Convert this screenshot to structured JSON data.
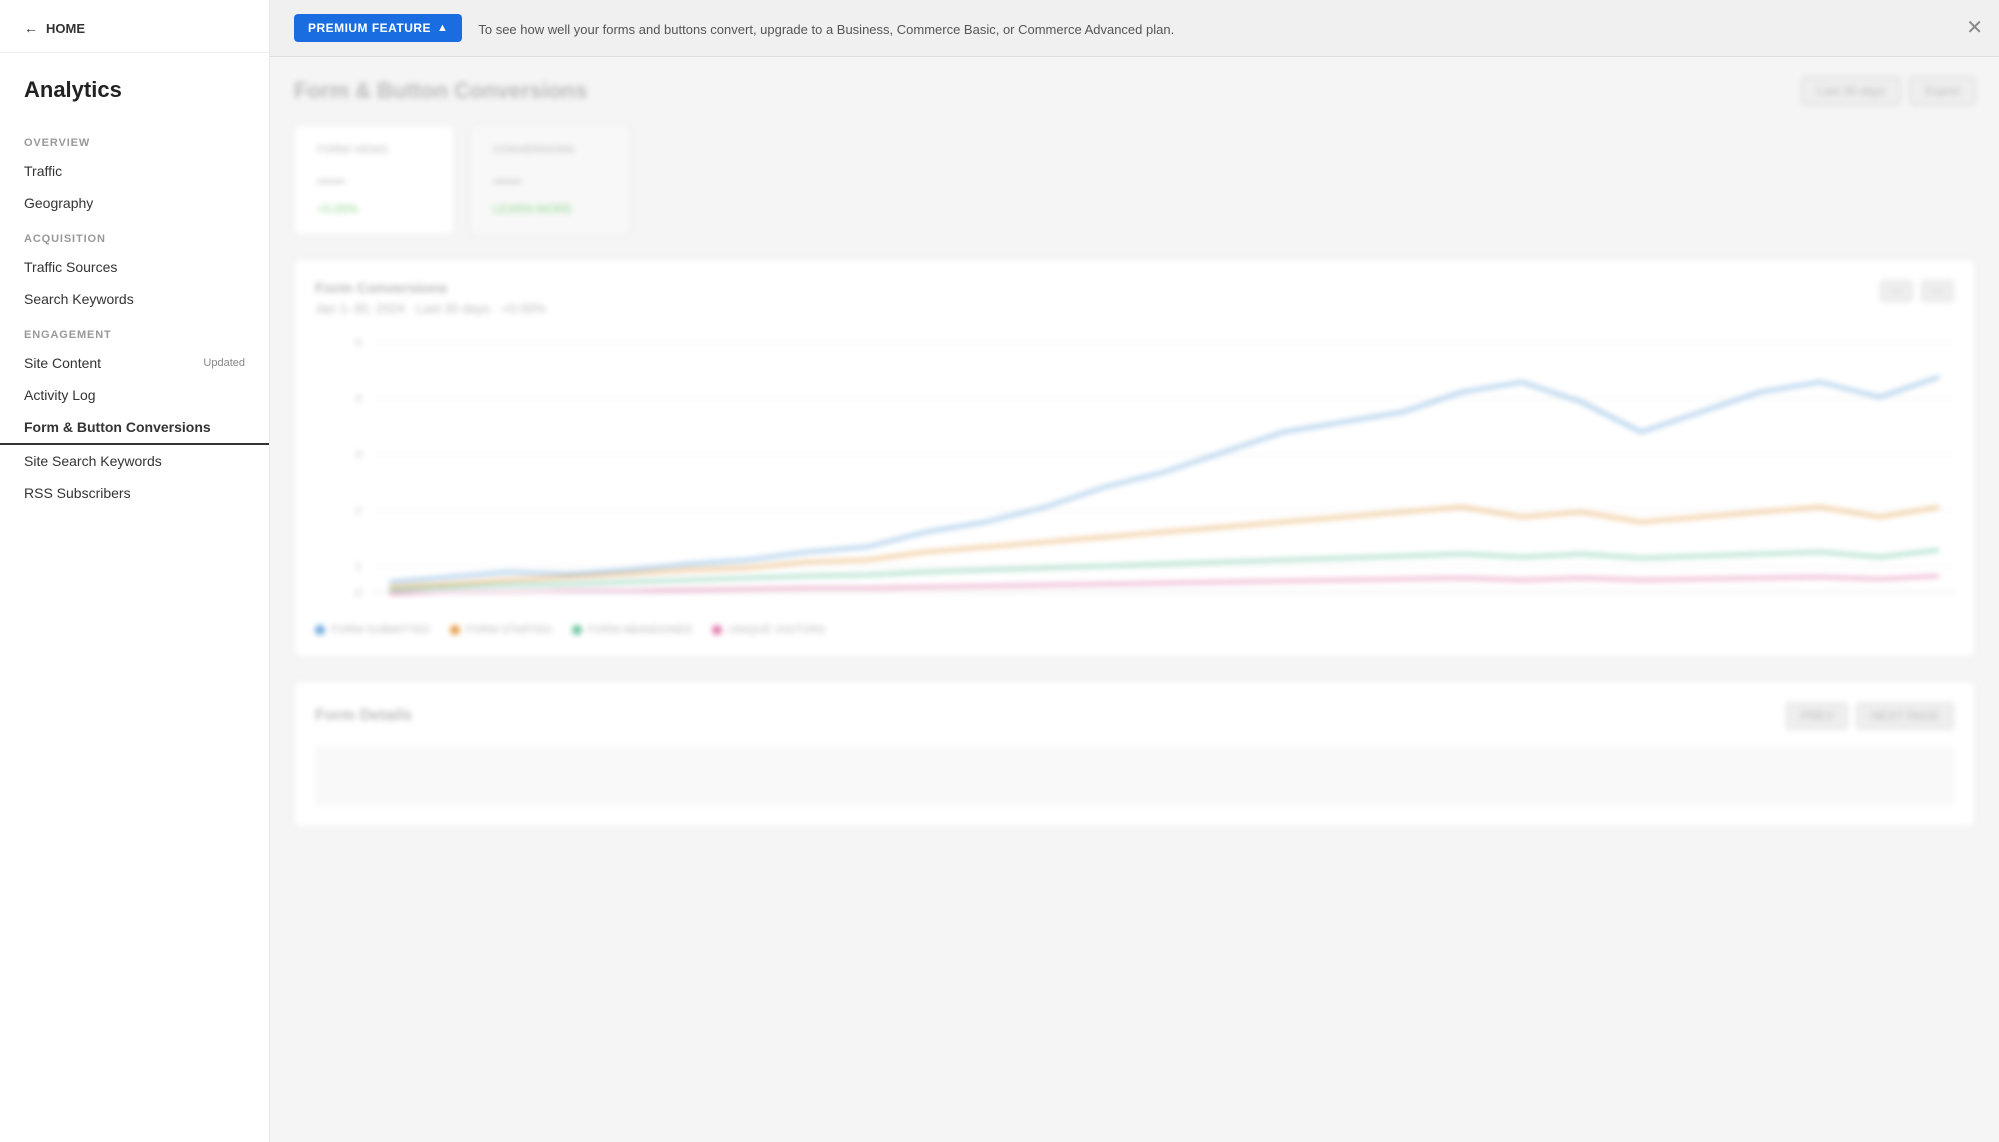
{
  "sidebar": {
    "home_label": "HOME",
    "title": "Analytics",
    "sections": [
      {
        "label": "OVERVIEW",
        "items": [
          {
            "id": "traffic",
            "label": "Traffic",
            "active": false,
            "badge": ""
          },
          {
            "id": "geography",
            "label": "Geography",
            "active": false,
            "badge": ""
          }
        ]
      },
      {
        "label": "ACQUISITION",
        "items": [
          {
            "id": "traffic-sources",
            "label": "Traffic Sources",
            "active": false,
            "badge": ""
          },
          {
            "id": "search-keywords",
            "label": "Search Keywords",
            "active": false,
            "badge": ""
          }
        ]
      },
      {
        "label": "ENGAGEMENT",
        "items": [
          {
            "id": "site-content",
            "label": "Site Content",
            "active": false,
            "badge": "Updated"
          },
          {
            "id": "activity-log",
            "label": "Activity Log",
            "active": false,
            "badge": ""
          },
          {
            "id": "form-button-conversions",
            "label": "Form & Button Conversions",
            "active": true,
            "badge": ""
          },
          {
            "id": "site-search-keywords",
            "label": "Site Search Keywords",
            "active": false,
            "badge": ""
          },
          {
            "id": "rss-subscribers",
            "label": "RSS Subscribers",
            "active": false,
            "badge": ""
          }
        ]
      }
    ]
  },
  "premium_banner": {
    "button_label": "PREMIUM FEATURE",
    "description": "To see how well your forms and buttons convert, upgrade to a Business, Commerce Basic, or Commerce Advanced plan."
  },
  "content": {
    "title": "Form & Button Conversions",
    "date_range": "Last 30 days",
    "export_label": "Export",
    "stat1": {
      "label": "FORM VIEWS",
      "value": "—",
      "change": "+0.00%"
    },
    "stat2": {
      "label": "CONVERSIONS",
      "value": "—",
      "change": "LEARN MORE"
    },
    "chart_subtitle": "Form Conversions",
    "chart_desc": "Jan 1–30, 2024 · Last 30 days · +0.00%",
    "y_labels": [
      "5",
      "4",
      "3",
      "2",
      "1",
      "0"
    ],
    "legend": [
      {
        "label": "FORM SUBMITTED",
        "color": "#6fa8dc"
      },
      {
        "label": "FORM STARTED",
        "color": "#e6a04c"
      },
      {
        "label": "FORM ABANDONED",
        "color": "#6cc5a0"
      },
      {
        "label": "UNIQUE VISITORS",
        "color": "#e07aaa"
      }
    ],
    "table_title": "Form Details",
    "prev_label": "PREV",
    "next_label": "NEXT PAGE"
  }
}
